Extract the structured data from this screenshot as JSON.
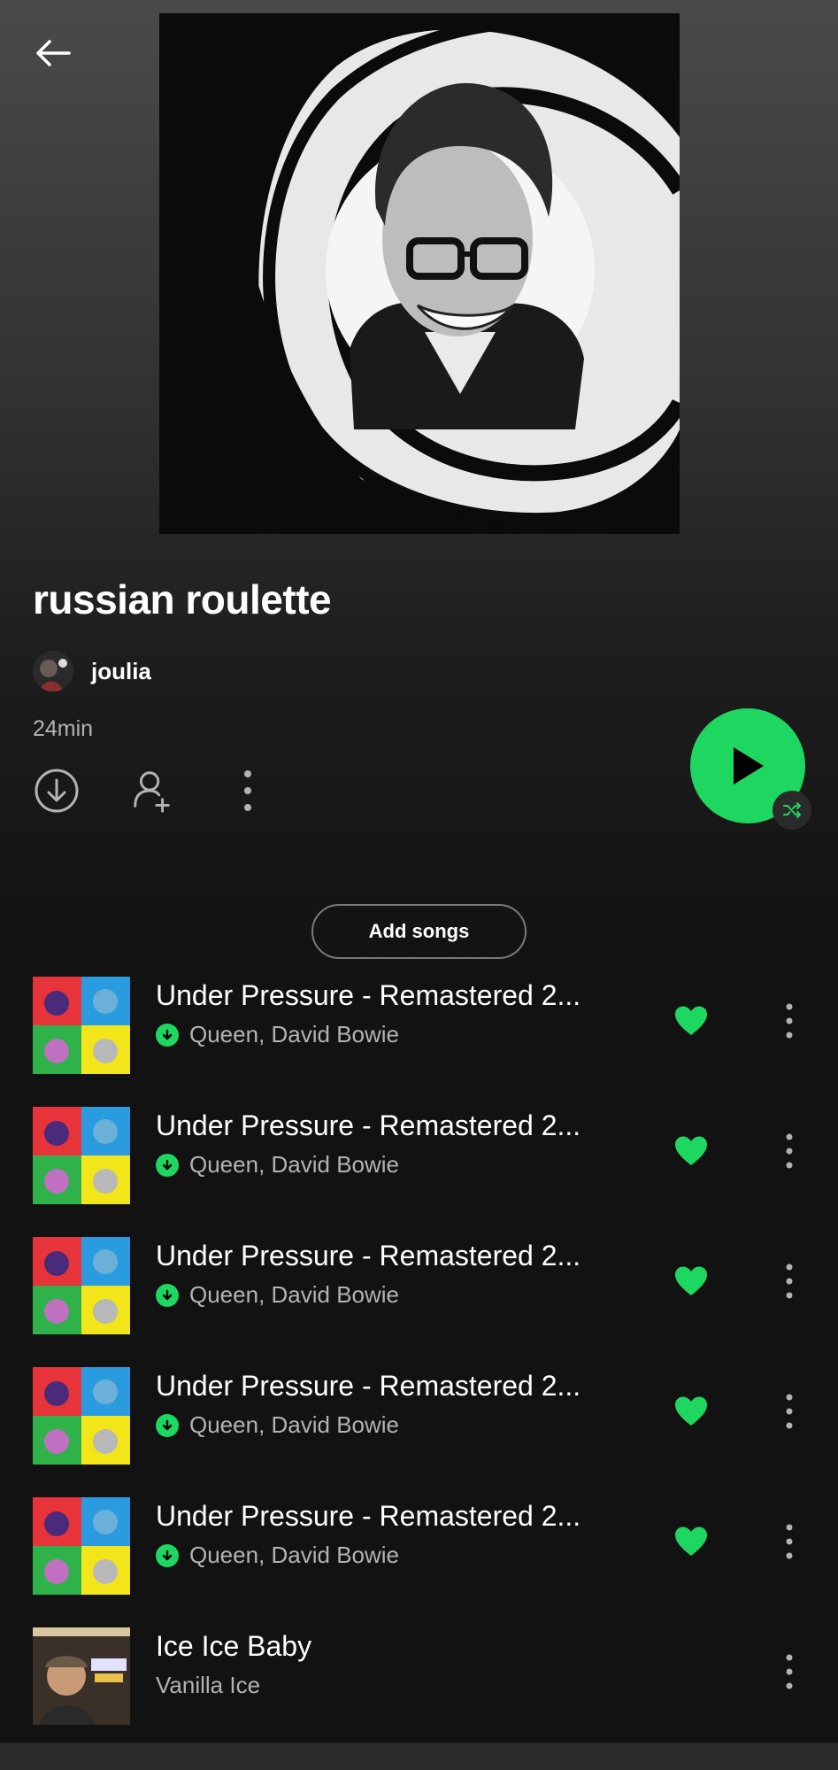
{
  "header": {
    "back_icon": "arrow-left-icon"
  },
  "playlist": {
    "title": "russian roulette",
    "owner": "joulia",
    "duration": "24min"
  },
  "actions": {
    "download_icon": "download-circle-icon",
    "add_user_icon": "add-user-icon",
    "more_icon": "more-vertical-icon",
    "play_icon": "play-icon",
    "shuffle_icon": "shuffle-icon",
    "accent_color": "#1ed760"
  },
  "add_songs_label": "Add songs",
  "tracks": [
    {
      "title": "Under Pressure - Remastered 2...",
      "artist": "Queen, David Bowie",
      "downloaded": true,
      "liked": true
    },
    {
      "title": "Under Pressure - Remastered 2...",
      "artist": "Queen, David Bowie",
      "downloaded": true,
      "liked": true
    },
    {
      "title": "Under Pressure - Remastered 2...",
      "artist": "Queen, David Bowie",
      "downloaded": true,
      "liked": true
    },
    {
      "title": "Under Pressure - Remastered 2...",
      "artist": "Queen, David Bowie",
      "downloaded": true,
      "liked": true
    },
    {
      "title": "Under Pressure - Remastered 2...",
      "artist": "Queen, David Bowie",
      "downloaded": true,
      "liked": true
    },
    {
      "title": "Ice Ice Baby",
      "artist": "Vanilla Ice",
      "downloaded": false,
      "liked": false
    }
  ]
}
